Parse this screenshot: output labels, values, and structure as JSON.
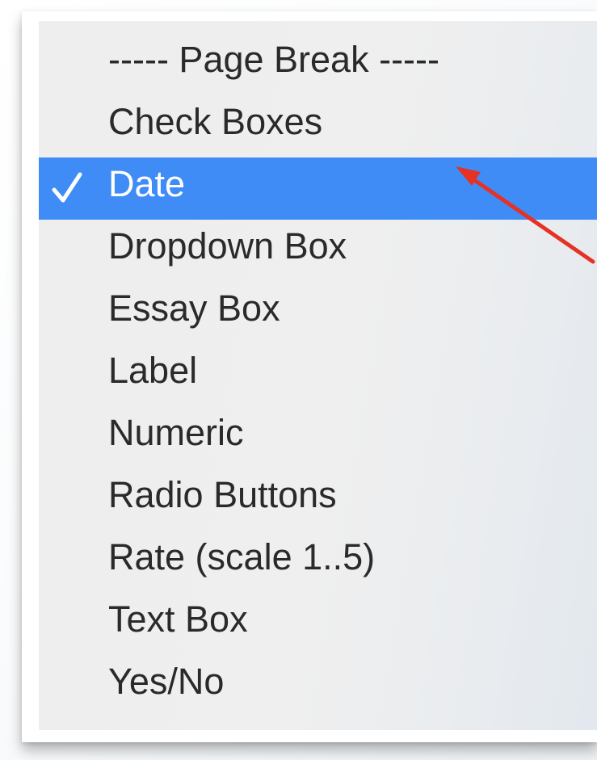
{
  "menu": {
    "items": [
      {
        "label": "----- Page Break -----",
        "selected": false
      },
      {
        "label": "Check Boxes",
        "selected": false
      },
      {
        "label": "Date",
        "selected": true
      },
      {
        "label": "Dropdown Box",
        "selected": false
      },
      {
        "label": "Essay Box",
        "selected": false
      },
      {
        "label": "Label",
        "selected": false
      },
      {
        "label": "Numeric",
        "selected": false
      },
      {
        "label": "Radio Buttons",
        "selected": false
      },
      {
        "label": "Rate (scale 1..5)",
        "selected": false
      },
      {
        "label": "Text Box",
        "selected": false
      },
      {
        "label": "Yes/No",
        "selected": false
      }
    ],
    "selected_color": "#3f8cf6",
    "check_icon": "checkmark-icon"
  },
  "annotation": {
    "arrow_color": "#e53225",
    "icon": "red-arrow-icon"
  }
}
